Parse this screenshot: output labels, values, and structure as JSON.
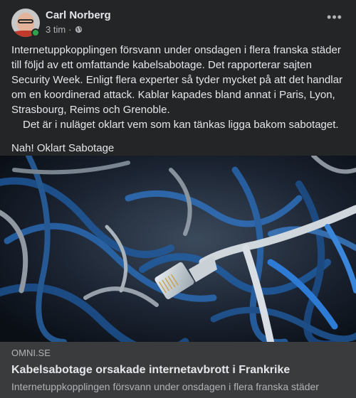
{
  "post": {
    "author": "Carl Norberg",
    "time": "3 tim",
    "separator": "·",
    "privacy_icon": "globe-icon",
    "more_icon": "more-horizontal-icon",
    "more_label": "•••",
    "paragraph1": "Internetuppkopplingen försvann under onsdagen i flera franska städer till följd av ett omfattande kabelsabotage. Det rapporterar sajten Security Week. Enligt flera experter så tyder mycket på att det handlar om en koordinerad attack. Kablar kapades bland annat i Paris, Lyon, Strasbourg, Reims och Grenoble.",
    "paragraph2": "Det är i nuläget oklart vem som kan tänkas ligga bakom sabotaget.",
    "comment": "Nah! Oklart Sabotage"
  },
  "link_preview": {
    "domain": "OMNI.SE",
    "title": "Kabelsabotage orsakade internetavbrott i Frankrike",
    "description": "Internetuppkopplingen försvann under onsdagen i flera franska städer"
  },
  "colors": {
    "card_bg": "#242526",
    "link_bg": "#3a3b3c",
    "text_primary": "#e4e6eb",
    "text_secondary": "#b0b3b8",
    "online": "#31a24c"
  }
}
